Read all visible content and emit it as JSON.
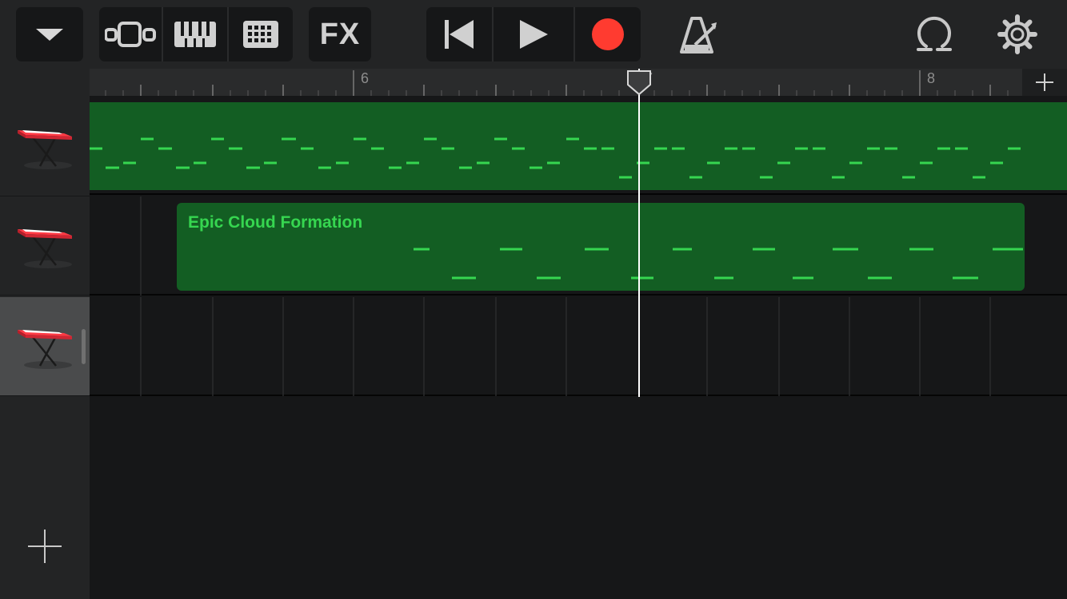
{
  "toolbar": {
    "tracks_menu_icon": "chevron-down-icon",
    "view_buttons": [
      "track-view-icon",
      "keyboard-icon",
      "grid-icon"
    ],
    "fx_label": "FX",
    "transport": [
      "rewind-icon",
      "play-icon",
      "record-icon"
    ],
    "metronome_icon": "metronome-icon",
    "loop_icon": "loop-icon",
    "settings_icon": "gear-icon"
  },
  "ruler": {
    "bars": [
      "6",
      "7",
      "8"
    ],
    "add_section_icon": "plus-icon"
  },
  "tracks": [
    {
      "instrument": "keyboard",
      "selected": false
    },
    {
      "instrument": "keyboard",
      "selected": false
    },
    {
      "instrument": "keyboard",
      "selected": true
    }
  ],
  "regions": [
    {
      "track": 1,
      "name": ""
    },
    {
      "track": 2,
      "name": "Epic Cloud Formation"
    }
  ],
  "sidebar": {
    "add_track_icon": "plus-icon"
  },
  "colors": {
    "region_fill": "#135e23",
    "note": "#36d650",
    "record": "#ff3b30",
    "background": "#161718",
    "toolbar": "#232425"
  }
}
